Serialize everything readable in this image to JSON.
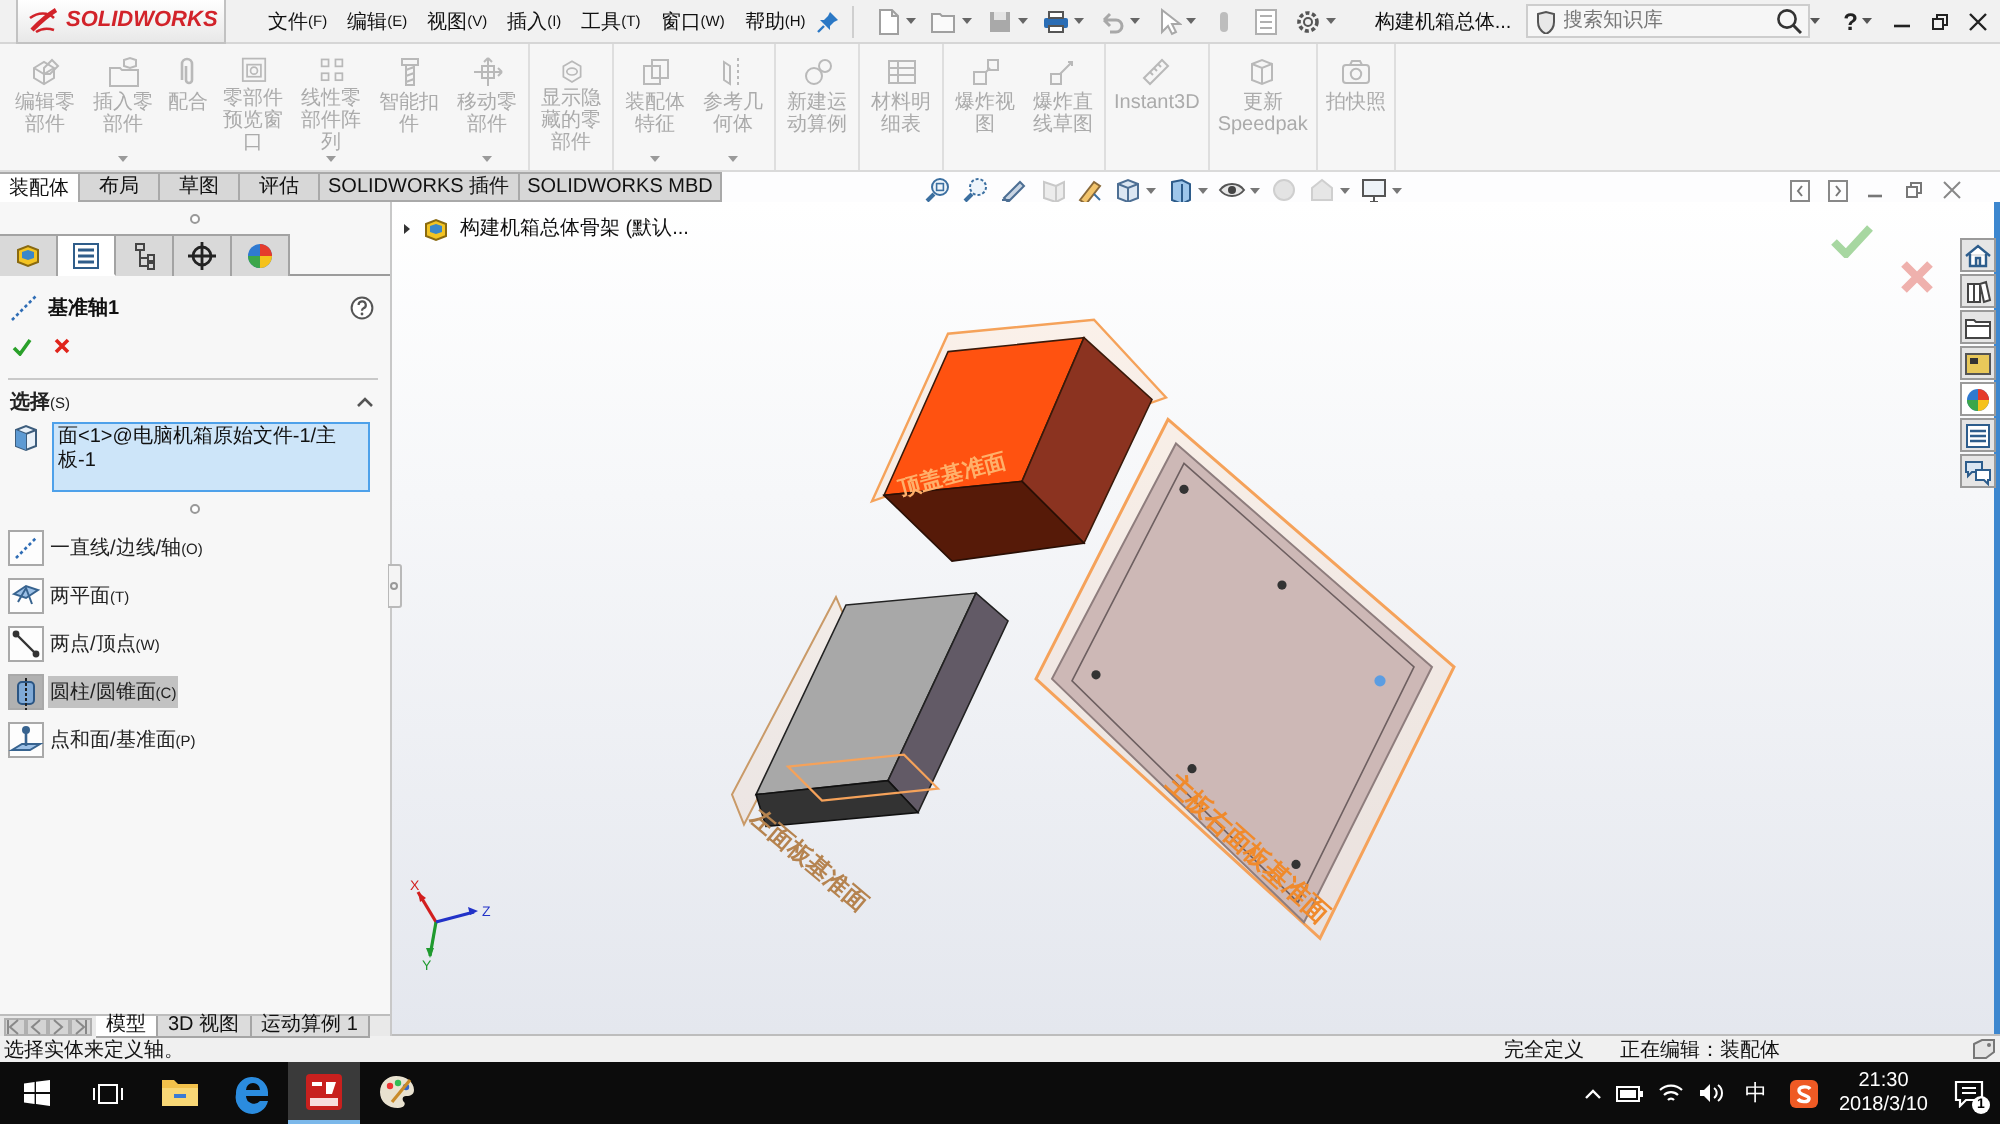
{
  "title_bar": {
    "logo": "SOLIDWORKS",
    "menu": [
      {
        "label": "文件",
        "key": "(F)"
      },
      {
        "label": "编辑",
        "key": "(E)"
      },
      {
        "label": "视图",
        "key": "(V)"
      },
      {
        "label": "插入",
        "key": "(I)"
      },
      {
        "label": "工具",
        "key": "(T)"
      },
      {
        "label": "窗口",
        "key": "(W)"
      },
      {
        "label": "帮助",
        "key": "(H)"
      }
    ],
    "document_title": "构建机箱总体...",
    "search": {
      "placeholder": "搜索知识库"
    },
    "help": "?"
  },
  "command_manager": {
    "groups": [
      [
        {
          "label": "编辑零部件",
          "dropdown": false,
          "disabled": true
        },
        {
          "label": "插入零部件",
          "dropdown": true,
          "disabled": true
        },
        {
          "label": "配合",
          "dropdown": false,
          "disabled": true
        },
        {
          "label": "零部件预览窗口",
          "dropdown": false,
          "disabled": true
        },
        {
          "label": "线性零部件阵列",
          "dropdown": true,
          "disabled": true
        },
        {
          "label": "智能扣件",
          "dropdown": false,
          "disabled": true
        },
        {
          "label": "移动零部件",
          "dropdown": true,
          "disabled": true
        }
      ],
      [
        {
          "label": "显示隐藏的零部件",
          "dropdown": false,
          "disabled": true
        }
      ],
      [
        {
          "label": "装配体特征",
          "dropdown": true,
          "disabled": true
        },
        {
          "label": "参考几何体",
          "dropdown": true,
          "disabled": true
        }
      ],
      [
        {
          "label": "新建运动算例",
          "dropdown": false,
          "disabled": true
        }
      ],
      [
        {
          "label": "材料明细表",
          "dropdown": false,
          "disabled": true
        }
      ],
      [
        {
          "label": "爆炸视图",
          "dropdown": false,
          "disabled": true
        },
        {
          "label": "爆炸直线草图",
          "dropdown": false,
          "disabled": true
        }
      ],
      [
        {
          "label": "Instant3D",
          "dropdown": false,
          "disabled": true
        }
      ],
      [
        {
          "label": "更新Speedpak",
          "dropdown": false,
          "disabled": true
        }
      ],
      [
        {
          "label": "拍快照",
          "dropdown": false,
          "disabled": true
        }
      ]
    ]
  },
  "tabs": [
    {
      "label": "装配体",
      "selected": true
    },
    {
      "label": "布局",
      "selected": false
    },
    {
      "label": "草图",
      "selected": false
    },
    {
      "label": "评估",
      "selected": false
    },
    {
      "label": "SOLIDWORKS 插件",
      "selected": false
    },
    {
      "label": "SOLIDWORKS MBD",
      "selected": false
    }
  ],
  "panel_tabs": [
    {
      "kind": "feature_tree",
      "selected": false
    },
    {
      "kind": "property",
      "selected": true
    },
    {
      "kind": "configuration",
      "selected": false
    },
    {
      "kind": "dimxpert",
      "selected": false
    },
    {
      "kind": "display",
      "selected": false
    }
  ],
  "property_manager": {
    "title": "基准轴1",
    "section": {
      "title": "选择",
      "key": "(S)",
      "expanded": true,
      "selection": "面<1>@电脑机箱原始文件-1/主板-1",
      "options": [
        {
          "kind": "line",
          "label": "一直线/边线/轴",
          "key": "(O)",
          "selected": false
        },
        {
          "kind": "two_planes",
          "label": "两平面",
          "key": "(T)",
          "selected": false
        },
        {
          "kind": "two_points",
          "label": "两点/顶点",
          "key": "(W)",
          "selected": false
        },
        {
          "kind": "cylinder",
          "label": "圆柱/圆锥面",
          "key": "(C)",
          "selected": true
        },
        {
          "kind": "point_face",
          "label": "点和面/基准面",
          "key": "(P)",
          "selected": false
        }
      ]
    }
  },
  "bottom_tabs": [
    {
      "label": "模型",
      "selected": true
    },
    {
      "label": "3D 视图",
      "selected": false
    },
    {
      "label": "运动算例 1",
      "selected": false
    }
  ],
  "viewport": {
    "tree_root": {
      "label": "构建机箱总体骨架 (默认...",
      "expanded": false
    },
    "plane_labels": [
      "左面板基准面",
      "主板右面板基准面",
      "顶盖基准面"
    ],
    "triad": [
      "X",
      "Y",
      "Z"
    ]
  },
  "status_bar": {
    "message": "选择实体来定义轴。",
    "items": [
      "完全定义",
      "正在编辑：装配体"
    ]
  },
  "taskbar": {
    "apps": [
      {
        "kind": "explorer",
        "selected": false
      },
      {
        "kind": "edge",
        "selected": false
      },
      {
        "kind": "solidworks",
        "selected": true
      },
      {
        "kind": "paint",
        "selected": false
      }
    ],
    "ime": "中",
    "time": "21:30",
    "date": "2018/3/10",
    "notifications": "1"
  }
}
